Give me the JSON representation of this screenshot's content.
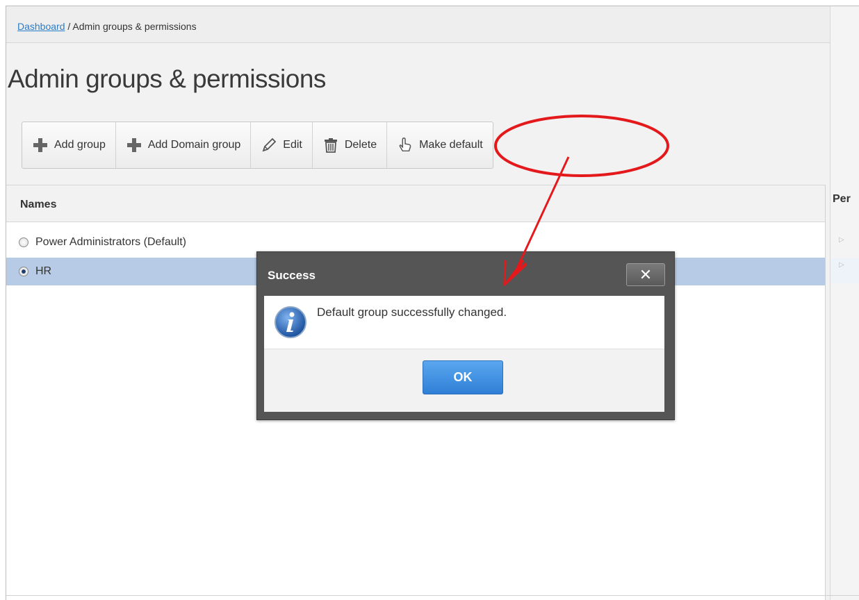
{
  "breadcrumb": {
    "link": "Dashboard",
    "separator": " / ",
    "current": "Admin groups & permissions"
  },
  "page": {
    "title": "Admin groups & permissions"
  },
  "toolbar": {
    "add_group": {
      "label": "Add group",
      "icon": "plus-icon"
    },
    "add_domain_group": {
      "label": "Add Domain group",
      "icon": "plus-icon"
    },
    "edit": {
      "label": "Edit",
      "icon": "pencil-icon"
    },
    "delete": {
      "label": "Delete",
      "icon": "trash-icon"
    },
    "make_default": {
      "label": "Make default",
      "icon": "hand-pointer-icon"
    }
  },
  "table": {
    "names_header": "Names",
    "permissions_header": "Per",
    "rows": [
      {
        "name": "Power Administrators (Default)",
        "selected": false
      },
      {
        "name": "HR",
        "selected": true
      }
    ]
  },
  "dialog": {
    "title": "Success",
    "close_label": "✕",
    "icon": "info-icon",
    "message": "Default group successfully changed.",
    "ok_label": "OK"
  },
  "colors": {
    "selected_row": "#b8cbe6",
    "dialog_frame": "#555555",
    "ok_button": "#3a8be0",
    "annotation": "#e4191c",
    "link": "#2a7cc7"
  }
}
